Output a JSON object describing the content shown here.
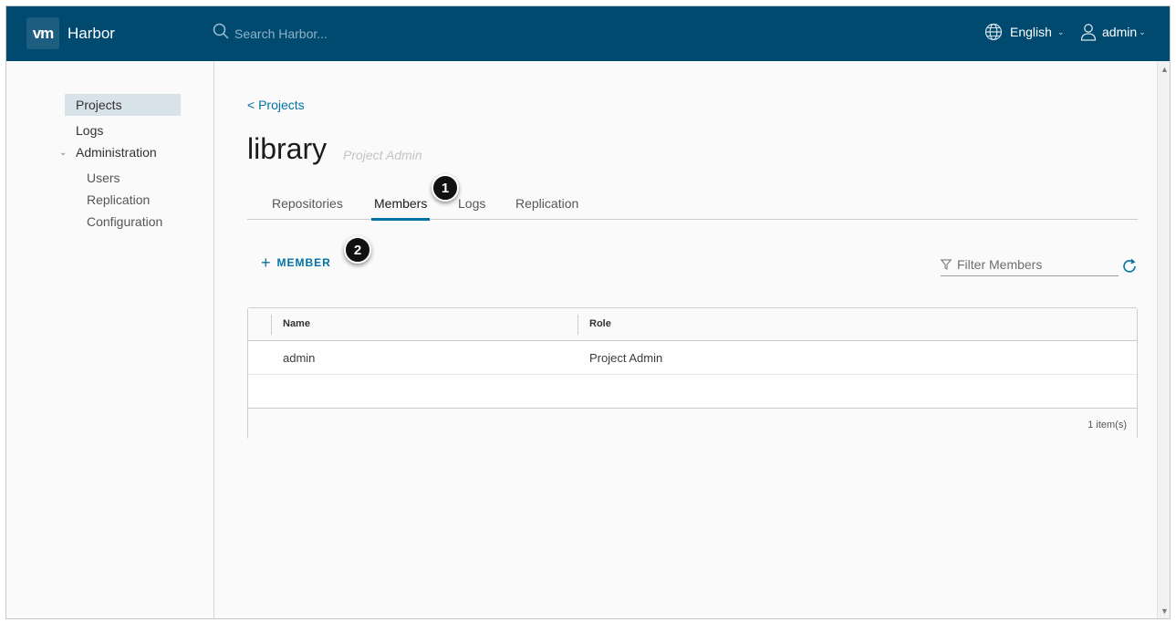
{
  "header": {
    "logo_text": "vm",
    "brand": "Harbor",
    "search_placeholder": "Search Harbor...",
    "language": "English",
    "user": "admin"
  },
  "sidebar": {
    "items": [
      {
        "label": "Projects",
        "active": true
      },
      {
        "label": "Logs",
        "active": false
      }
    ],
    "group": {
      "label": "Administration",
      "children": [
        {
          "label": "Users"
        },
        {
          "label": "Replication"
        },
        {
          "label": "Configuration"
        }
      ]
    }
  },
  "main": {
    "breadcrumb": "< Projects",
    "title": "library",
    "role_tag": "Project Admin",
    "tabs": [
      {
        "label": "Repositories",
        "active": false
      },
      {
        "label": "Members",
        "active": true
      },
      {
        "label": "Logs",
        "active": false
      },
      {
        "label": "Replication",
        "active": false
      }
    ],
    "callouts": [
      "1",
      "2"
    ],
    "add_member_label": "MEMBER",
    "filter_placeholder": "Filter Members",
    "table": {
      "columns": [
        "Name",
        "Role"
      ],
      "rows": [
        [
          "admin",
          "Project Admin"
        ]
      ],
      "count": "1 item(s)"
    }
  },
  "colors": {
    "header_bg": "#004a70",
    "accent": "#0072a3",
    "active_nav_bg": "#d8e3e9"
  },
  "icons": [
    "search-icon",
    "globe-icon",
    "user-icon",
    "chevron-down-icon",
    "plus-icon",
    "filter-icon",
    "refresh-icon"
  ]
}
